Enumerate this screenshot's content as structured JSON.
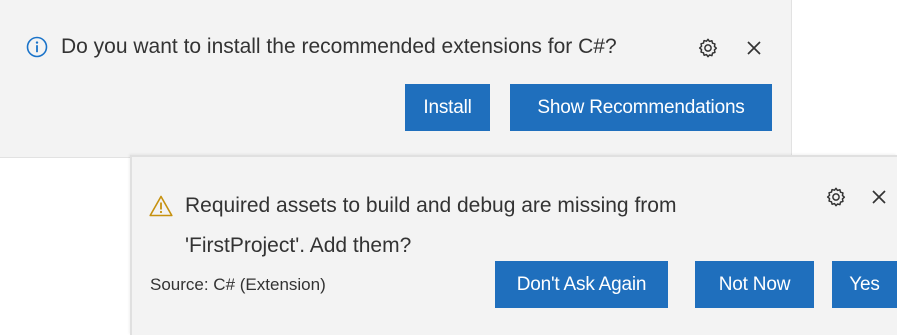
{
  "notification_top": {
    "message": "Do you want to install the recommended extensions for C#?",
    "lead_icon": "info-icon",
    "settings_icon": "gear-icon",
    "close_icon": "close-icon",
    "buttons": {
      "install": "Install",
      "show_recommendations": "Show Recommendations"
    }
  },
  "notification_bottom": {
    "message": "Required assets to build and debug are missing from\n'FirstProject'. Add them?",
    "lead_icon": "warning-icon",
    "settings_icon": "gear-icon",
    "close_icon": "close-icon",
    "source": "Source: C# (Extension)",
    "buttons": {
      "dont_ask_again": "Don't Ask Again",
      "not_now": "Not Now",
      "yes": "Yes"
    }
  },
  "colors": {
    "toast_background": "#f3f3f3",
    "button_primary": "#1f6fbd",
    "button_text": "#ffffff",
    "info_icon": "#1a73c9",
    "warning_icon": "#c6910f"
  }
}
